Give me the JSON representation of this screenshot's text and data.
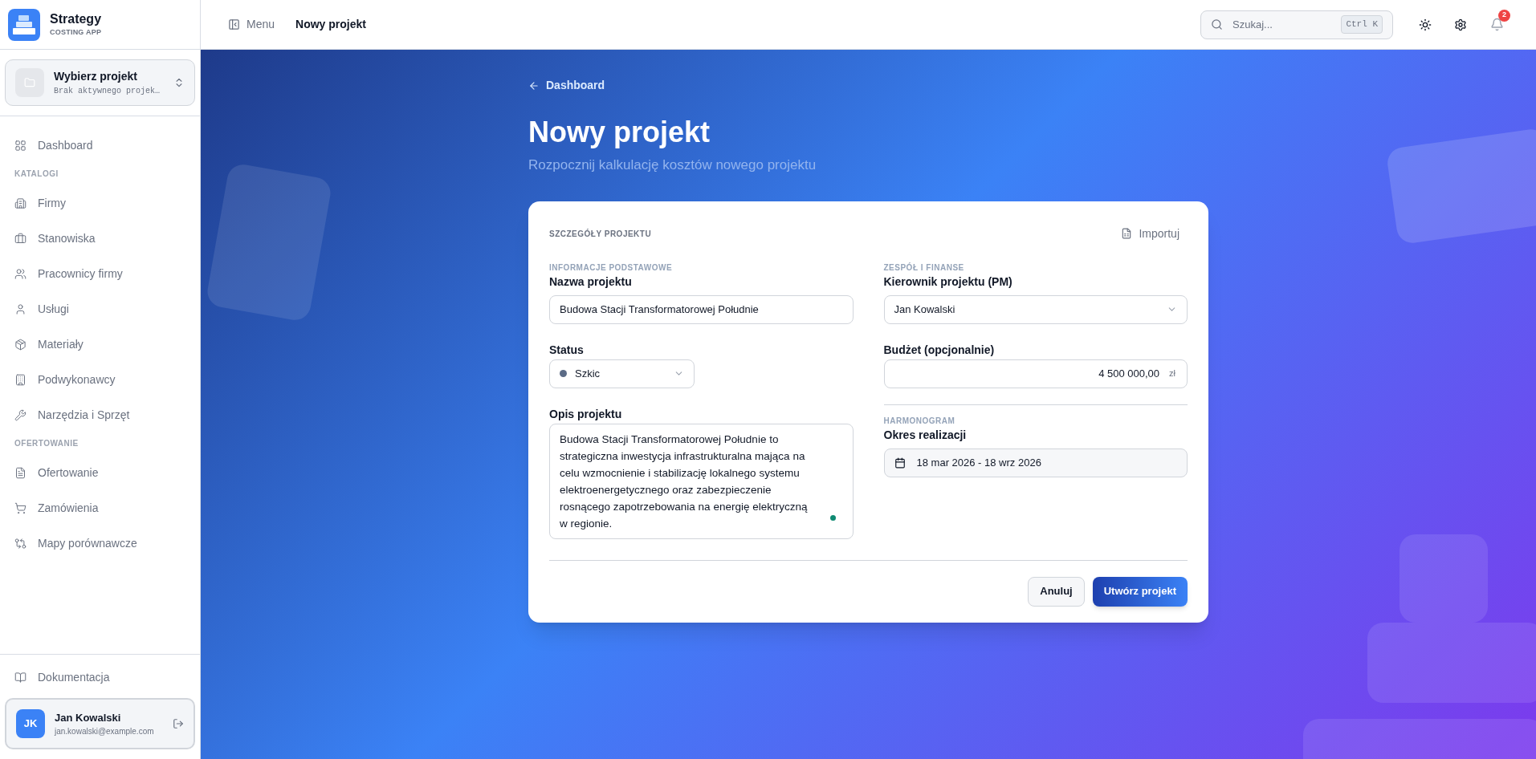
{
  "brand": {
    "name": "Strategy",
    "tagline": "COSTING APP"
  },
  "project_switcher": {
    "title": "Wybierz projekt",
    "subtitle": "Brak aktywnego projek…"
  },
  "nav_sections": [
    {
      "items": [
        {
          "label": "Dashboard"
        }
      ]
    },
    {
      "heading": "KATALOGI",
      "items": [
        {
          "label": "Firmy"
        },
        {
          "label": "Stanowiska"
        },
        {
          "label": "Pracownicy firmy"
        },
        {
          "label": "Usługi"
        },
        {
          "label": "Materiały"
        },
        {
          "label": "Podwykonawcy"
        },
        {
          "label": "Narzędzia i Sprzęt"
        }
      ]
    },
    {
      "heading": "OFERTOWANIE",
      "items": [
        {
          "label": "Ofertowanie"
        },
        {
          "label": "Zamówienia"
        },
        {
          "label": "Mapy porównawcze"
        }
      ]
    }
  ],
  "footer_link": "Dokumentacja",
  "user": {
    "initials": "JK",
    "name": "Jan Kowalski",
    "email": "jan.kowalski@example.com"
  },
  "topbar": {
    "menu": "Menu",
    "breadcrumb": "Nowy projekt",
    "search_placeholder": "Szukaj...",
    "shortcut": "Ctrl K",
    "notifications": "2"
  },
  "page": {
    "back": "Dashboard",
    "title": "Nowy projekt",
    "subtitle": "Rozpocznij kalkulację kosztów nowego projektu"
  },
  "form": {
    "title": "SZCZEGÓŁY PROJEKTU",
    "import": "Importuj",
    "basic_heading": "INFORMACJE PODSTAWOWE",
    "name_label": "Nazwa projektu",
    "name_value": "Budowa Stacji Transformatorowej Południe",
    "status_label": "Status",
    "status_value": "Szkic",
    "description_label": "Opis projektu",
    "description_value": "Budowa Stacji Transformatorowej Południe to strategiczna inwestycja infrastrukturalna mająca na celu wzmocnienie i stabilizację lokalnego systemu elektroenergetycznego oraz zabezpieczenie rosnącego zapotrzebowania na energię elektryczną w regionie.",
    "team_heading": "ZESPÓŁ I FINANSE",
    "pm_label": "Kierownik projektu (PM)",
    "pm_value": "Jan Kowalski",
    "budget_label": "Budżet (opcjonalnie)",
    "budget_value": "4 500 000,00",
    "budget_currency": "zł",
    "schedule_heading": "HARMONOGRAM",
    "period_label": "Okres realizacji",
    "period_value": "18 mar 2026 - 18 wrz 2026",
    "cancel": "Anuluj",
    "submit": "Utwórz projekt"
  }
}
